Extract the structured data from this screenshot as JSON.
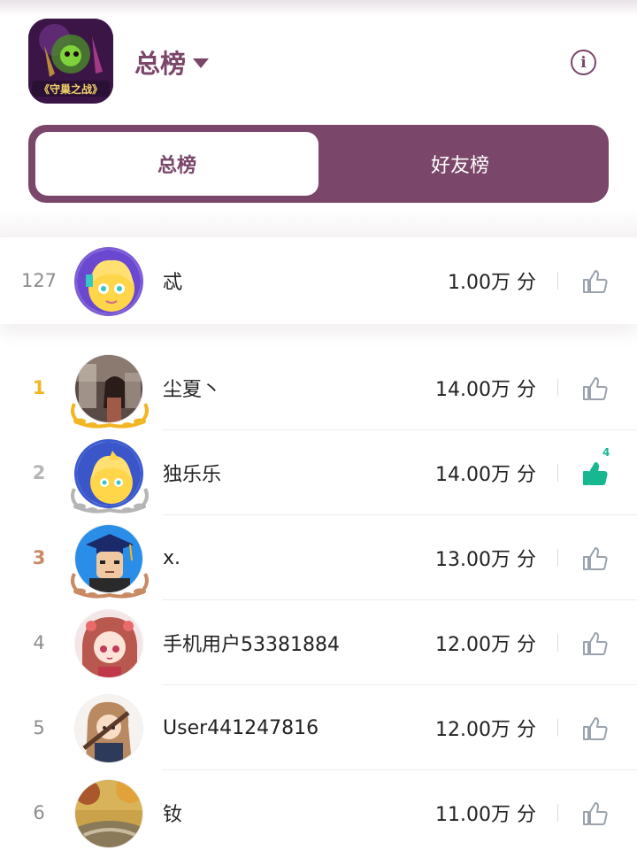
{
  "header": {
    "game_icon_text": "《守巢之战》",
    "board_title": "总榜",
    "info_label": "i"
  },
  "tabs": [
    {
      "label": "总榜",
      "active": true
    },
    {
      "label": "好友榜",
      "active": false
    }
  ],
  "my_rank": {
    "rank": "127",
    "name": "忒",
    "score": "1.00万 分",
    "liked": false
  },
  "leaderboard": [
    {
      "rank": "1",
      "name": "尘夏丶",
      "score": "14.00万 分",
      "medal": "gold",
      "liked": false,
      "like_count": ""
    },
    {
      "rank": "2",
      "name": "独乐乐",
      "score": "14.00万 分",
      "medal": "silver",
      "liked": true,
      "like_count": "4"
    },
    {
      "rank": "3",
      "name": "x.",
      "score": "13.00万 分",
      "medal": "bronze",
      "liked": false,
      "like_count": ""
    },
    {
      "rank": "4",
      "name": "手机用户53381884",
      "score": "12.00万 分",
      "medal": "",
      "liked": false,
      "like_count": ""
    },
    {
      "rank": "5",
      "name": "User441247816",
      "score": "12.00万 分",
      "medal": "",
      "liked": false,
      "like_count": ""
    },
    {
      "rank": "6",
      "name": "钕",
      "score": "11.00万 分",
      "medal": "",
      "liked": false,
      "like_count": ""
    }
  ],
  "colors": {
    "brand": "#7a4669",
    "like_active": "#17b890",
    "gold": "#f2b625",
    "silver": "#b5b5b5",
    "bronze": "#c98963",
    "like_inactive": "#9aa3ad"
  },
  "icons": {
    "like": "thumbs-up-icon",
    "info": "info-circle-icon",
    "dropdown": "caret-down-icon"
  }
}
